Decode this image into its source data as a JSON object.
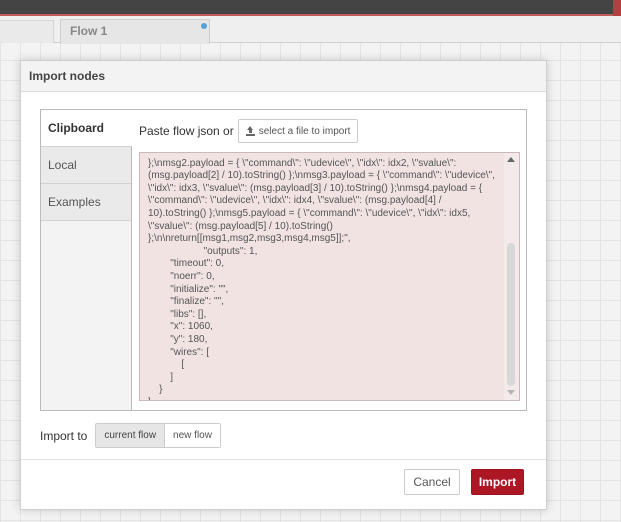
{
  "workspace": {
    "flow_tab_label": "Flow 1"
  },
  "dialog": {
    "title": "Import nodes",
    "tabs": [
      {
        "label": "Clipboard",
        "active": true
      },
      {
        "label": "Local",
        "active": false
      },
      {
        "label": "Examples",
        "active": false
      }
    ],
    "paste_label": "Paste flow json or",
    "file_button_label": "select a file to import",
    "editor_text": "                                                                                       \n};\\nmsg2.payload = { \\\"command\\\": \\\"udevice\\\", \\\"idx\\\": idx2, \\\"svalue\\\": (msg.payload[2] / 10).toString() };\\nmsg3.payload = { \\\"command\\\": \\\"udevice\\\", \\\"idx\\\": idx3, \\\"svalue\\\": (msg.payload[3] / 10).toString() };\\nmsg4.payload = { \\\"command\\\": \\\"udevice\\\", \\\"idx\\\": idx4, \\\"svalue\\\": (msg.payload[4] / 10).toString() };\\nmsg5.payload = { \\\"command\\\": \\\"udevice\\\", \\\"idx\\\": idx5, \\\"svalue\\\": (msg.payload[5] / 10).toString() };\\n\\nreturn[[msg1,msg2,msg3,msg4,msg5]];\",\n                    \"outputs\": 1,\n        \"timeout\": 0,\n        \"noerr\": 0,\n        \"initialize\": \"\",\n        \"finalize\": \"\",\n        \"libs\": [],\n        \"x\": 1060,\n        \"y\": 180,\n        \"wires\": [\n            [\n        ]\n    }\n]",
    "import_to_label": "Import to",
    "import_to_options": [
      {
        "label": "current flow",
        "selected": true
      },
      {
        "label": "new flow",
        "selected": false
      }
    ],
    "cancel_label": "Cancel",
    "import_label": "Import"
  },
  "colors": {
    "accent": "#ad1625",
    "editor_bg": "#f2e3e3"
  }
}
